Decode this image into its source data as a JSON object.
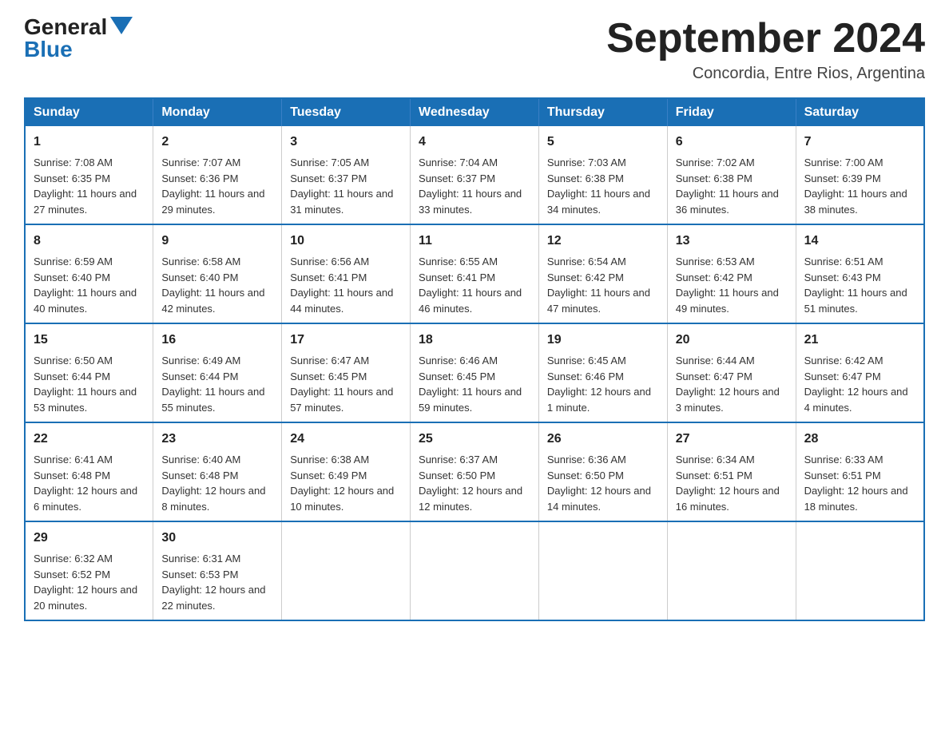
{
  "header": {
    "logo_general": "General",
    "logo_blue": "Blue",
    "title": "September 2024",
    "location": "Concordia, Entre Rios, Argentina"
  },
  "weekdays": [
    "Sunday",
    "Monday",
    "Tuesday",
    "Wednesday",
    "Thursday",
    "Friday",
    "Saturday"
  ],
  "weeks": [
    [
      {
        "day": "1",
        "sunrise": "7:08 AM",
        "sunset": "6:35 PM",
        "daylight": "11 hours and 27 minutes."
      },
      {
        "day": "2",
        "sunrise": "7:07 AM",
        "sunset": "6:36 PM",
        "daylight": "11 hours and 29 minutes."
      },
      {
        "day": "3",
        "sunrise": "7:05 AM",
        "sunset": "6:37 PM",
        "daylight": "11 hours and 31 minutes."
      },
      {
        "day": "4",
        "sunrise": "7:04 AM",
        "sunset": "6:37 PM",
        "daylight": "11 hours and 33 minutes."
      },
      {
        "day": "5",
        "sunrise": "7:03 AM",
        "sunset": "6:38 PM",
        "daylight": "11 hours and 34 minutes."
      },
      {
        "day": "6",
        "sunrise": "7:02 AM",
        "sunset": "6:38 PM",
        "daylight": "11 hours and 36 minutes."
      },
      {
        "day": "7",
        "sunrise": "7:00 AM",
        "sunset": "6:39 PM",
        "daylight": "11 hours and 38 minutes."
      }
    ],
    [
      {
        "day": "8",
        "sunrise": "6:59 AM",
        "sunset": "6:40 PM",
        "daylight": "11 hours and 40 minutes."
      },
      {
        "day": "9",
        "sunrise": "6:58 AM",
        "sunset": "6:40 PM",
        "daylight": "11 hours and 42 minutes."
      },
      {
        "day": "10",
        "sunrise": "6:56 AM",
        "sunset": "6:41 PM",
        "daylight": "11 hours and 44 minutes."
      },
      {
        "day": "11",
        "sunrise": "6:55 AM",
        "sunset": "6:41 PM",
        "daylight": "11 hours and 46 minutes."
      },
      {
        "day": "12",
        "sunrise": "6:54 AM",
        "sunset": "6:42 PM",
        "daylight": "11 hours and 47 minutes."
      },
      {
        "day": "13",
        "sunrise": "6:53 AM",
        "sunset": "6:42 PM",
        "daylight": "11 hours and 49 minutes."
      },
      {
        "day": "14",
        "sunrise": "6:51 AM",
        "sunset": "6:43 PM",
        "daylight": "11 hours and 51 minutes."
      }
    ],
    [
      {
        "day": "15",
        "sunrise": "6:50 AM",
        "sunset": "6:44 PM",
        "daylight": "11 hours and 53 minutes."
      },
      {
        "day": "16",
        "sunrise": "6:49 AM",
        "sunset": "6:44 PM",
        "daylight": "11 hours and 55 minutes."
      },
      {
        "day": "17",
        "sunrise": "6:47 AM",
        "sunset": "6:45 PM",
        "daylight": "11 hours and 57 minutes."
      },
      {
        "day": "18",
        "sunrise": "6:46 AM",
        "sunset": "6:45 PM",
        "daylight": "11 hours and 59 minutes."
      },
      {
        "day": "19",
        "sunrise": "6:45 AM",
        "sunset": "6:46 PM",
        "daylight": "12 hours and 1 minute."
      },
      {
        "day": "20",
        "sunrise": "6:44 AM",
        "sunset": "6:47 PM",
        "daylight": "12 hours and 3 minutes."
      },
      {
        "day": "21",
        "sunrise": "6:42 AM",
        "sunset": "6:47 PM",
        "daylight": "12 hours and 4 minutes."
      }
    ],
    [
      {
        "day": "22",
        "sunrise": "6:41 AM",
        "sunset": "6:48 PM",
        "daylight": "12 hours and 6 minutes."
      },
      {
        "day": "23",
        "sunrise": "6:40 AM",
        "sunset": "6:48 PM",
        "daylight": "12 hours and 8 minutes."
      },
      {
        "day": "24",
        "sunrise": "6:38 AM",
        "sunset": "6:49 PM",
        "daylight": "12 hours and 10 minutes."
      },
      {
        "day": "25",
        "sunrise": "6:37 AM",
        "sunset": "6:50 PM",
        "daylight": "12 hours and 12 minutes."
      },
      {
        "day": "26",
        "sunrise": "6:36 AM",
        "sunset": "6:50 PM",
        "daylight": "12 hours and 14 minutes."
      },
      {
        "day": "27",
        "sunrise": "6:34 AM",
        "sunset": "6:51 PM",
        "daylight": "12 hours and 16 minutes."
      },
      {
        "day": "28",
        "sunrise": "6:33 AM",
        "sunset": "6:51 PM",
        "daylight": "12 hours and 18 minutes."
      }
    ],
    [
      {
        "day": "29",
        "sunrise": "6:32 AM",
        "sunset": "6:52 PM",
        "daylight": "12 hours and 20 minutes."
      },
      {
        "day": "30",
        "sunrise": "6:31 AM",
        "sunset": "6:53 PM",
        "daylight": "12 hours and 22 minutes."
      },
      null,
      null,
      null,
      null,
      null
    ]
  ]
}
